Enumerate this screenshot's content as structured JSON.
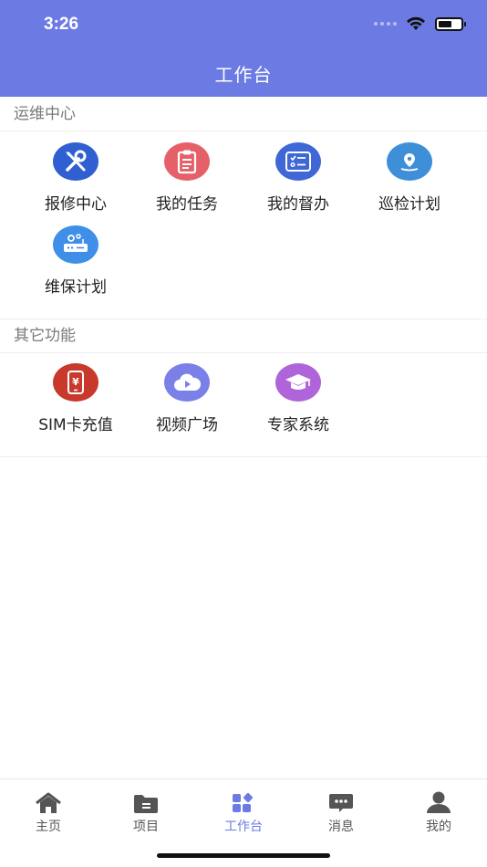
{
  "status_bar": {
    "time": "3:26"
  },
  "header": {
    "title": "工作台"
  },
  "colors": {
    "header_bg": "#6b7be3",
    "active_tab": "#6b7be3"
  },
  "sections": [
    {
      "title": "运维中心",
      "items": [
        {
          "label": "报修中心",
          "icon": "wrench-screwdriver-icon",
          "color": "#2f5fd0"
        },
        {
          "label": "我的任务",
          "icon": "clipboard-icon",
          "color": "#e56068"
        },
        {
          "label": "我的督办",
          "icon": "checklist-icon",
          "color": "#3f67d6"
        },
        {
          "label": "巡检计划",
          "icon": "location-pin-icon",
          "color": "#3f8fd8"
        },
        {
          "label": "维保计划",
          "icon": "router-gear-icon",
          "color": "#3f8fe8"
        }
      ]
    },
    {
      "title": "其它功能",
      "items": [
        {
          "label": "SIM卡充值",
          "icon": "phone-yuan-icon",
          "color": "#c8382b"
        },
        {
          "label": "视频广场",
          "icon": "cloud-play-icon",
          "color": "#7b7fe8"
        },
        {
          "label": "专家系统",
          "icon": "graduation-cap-icon",
          "color": "#b064d9"
        }
      ]
    }
  ],
  "tabbar": [
    {
      "label": "主页",
      "icon": "home-icon",
      "active": false
    },
    {
      "label": "项目",
      "icon": "folder-icon",
      "active": false
    },
    {
      "label": "工作台",
      "icon": "workbench-icon",
      "active": true
    },
    {
      "label": "消息",
      "icon": "message-icon",
      "active": false
    },
    {
      "label": "我的",
      "icon": "person-icon",
      "active": false
    }
  ]
}
